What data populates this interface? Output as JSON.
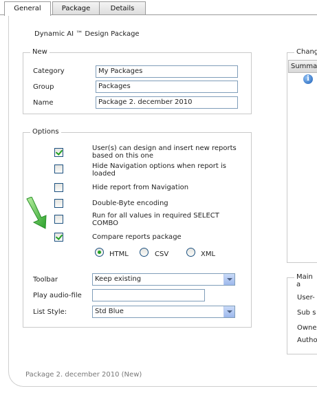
{
  "tabs": [
    {
      "label": "General",
      "active": true
    },
    {
      "label": "Package",
      "active": false
    },
    {
      "label": "Details",
      "active": false
    }
  ],
  "page_title": "Dynamic AI ™ Design Package",
  "new_group": {
    "legend": "New",
    "category": {
      "label": "Category",
      "value": "My Packages"
    },
    "group": {
      "label": "Group",
      "value": "Packages"
    },
    "name": {
      "label": "Name",
      "value": "Package 2. december 2010"
    }
  },
  "options_group": {
    "legend": "Options",
    "checkboxes": [
      {
        "label": "User(s) can design and insert new reports based on this one",
        "checked": true
      },
      {
        "label": "Hide Navigation options when report is loaded",
        "checked": false
      },
      {
        "label": "Hide report from Navigation",
        "checked": false
      },
      {
        "label": "Double-Byte encoding",
        "checked": false
      },
      {
        "label": "Run for all values in required SELECT COMBO",
        "checked": false
      },
      {
        "label": "Compare reports package",
        "checked": true
      }
    ],
    "format_radios": [
      {
        "label": "HTML",
        "checked": true
      },
      {
        "label": "CSV",
        "checked": false
      },
      {
        "label": "XML",
        "checked": false
      }
    ],
    "toolbar": {
      "label": "Toolbar",
      "value": "Keep existing"
    },
    "play_audio": {
      "label": "Play audio-file",
      "value": ""
    },
    "list_style": {
      "label": "List Style:",
      "value": "Std Blue"
    }
  },
  "right_panel": {
    "changes_legend": "Chang",
    "table_header": "Summa",
    "main_legend": "Main a",
    "fields": [
      "User-",
      "Sub s",
      "Owne",
      "Autho"
    ]
  },
  "footer_status": "Package 2. december 2010 (New)",
  "colors": {
    "accent_green": "#21a121",
    "input_border": "#7f9db9",
    "tab_border": "#9a9a9a"
  }
}
